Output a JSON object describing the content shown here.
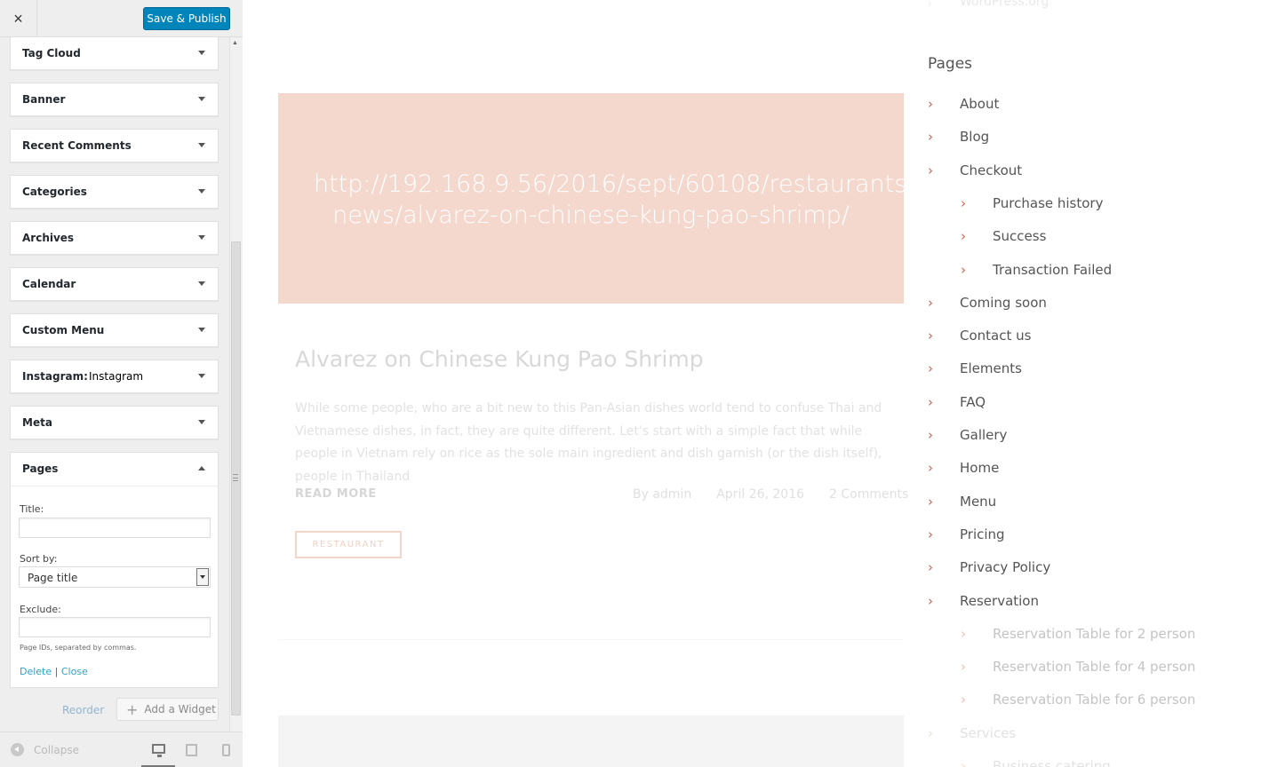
{
  "header": {
    "close_icon": "×",
    "publish_label": "Save & Publish"
  },
  "widgets": [
    {
      "title": "Tag Cloud",
      "sub": ""
    },
    {
      "title": "Banner",
      "sub": ""
    },
    {
      "title": "Recent Comments",
      "sub": ""
    },
    {
      "title": "Categories",
      "sub": ""
    },
    {
      "title": "Archives",
      "sub": ""
    },
    {
      "title": "Calendar",
      "sub": ""
    },
    {
      "title": "Custom Menu",
      "sub": ""
    },
    {
      "title": "Instagram:",
      "sub": "Instagram"
    },
    {
      "title": "Meta",
      "sub": ""
    }
  ],
  "pages_widget": {
    "title": "Pages",
    "title_label": "Title:",
    "title_value": "",
    "sort_label": "Sort by:",
    "sort_value": "Page title",
    "exclude_label": "Exclude:",
    "exclude_value": "",
    "hint": "Page IDs, separated by commas.",
    "delete_label": "Delete",
    "separator": "|",
    "close_label": "Close"
  },
  "actions": {
    "reorder_label": "Reorder",
    "add_widget_label": "Add a Widget"
  },
  "footer": {
    "collapse_label": "Collapse"
  },
  "preview": {
    "banner_text": "http://192.168.9.56/2016/sept/60108/restaurants-news/alvarez-on-chinese-kung-pao-shrimp/",
    "post_title": "Alvarez on Chinese Kung Pao Shrimp",
    "excerpt": "While some people, who are a bit new to this Pan-Asian dishes world tend to confuse Thai and Vietnamese dishes, in fact, they are quite different. Let's start with a simple fact that while people in Vietnam rely on rice as the sole main ingredient and dish garnish (or the dish itself), people in Thailand",
    "read_more": "READ MORE",
    "author": "By admin",
    "date": "April 26, 2016",
    "comments": "2 Comments",
    "tag": "RESTAURANT"
  },
  "pages_sidebar": {
    "top_link": "WordPress.org",
    "heading": "Pages",
    "items": [
      {
        "label": "About",
        "level": 0
      },
      {
        "label": "Blog",
        "level": 0
      },
      {
        "label": "Checkout",
        "level": 0
      },
      {
        "label": "Purchase history",
        "level": 1
      },
      {
        "label": "Success",
        "level": 1
      },
      {
        "label": "Transaction Failed",
        "level": 1
      },
      {
        "label": "Coming soon",
        "level": 0
      },
      {
        "label": "Contact us",
        "level": 0
      },
      {
        "label": "Elements",
        "level": 0
      },
      {
        "label": "FAQ",
        "level": 0
      },
      {
        "label": "Gallery",
        "level": 0
      },
      {
        "label": "Home",
        "level": 0
      },
      {
        "label": "Menu",
        "level": 0
      },
      {
        "label": "Pricing",
        "level": 0
      },
      {
        "label": "Privacy Policy",
        "level": 0
      },
      {
        "label": "Reservation",
        "level": 0
      },
      {
        "label": "Reservation Table for 2 person",
        "level": 1
      },
      {
        "label": "Reservation Table for 4 person",
        "level": 1
      },
      {
        "label": "Reservation Table for 6 person",
        "level": 1
      },
      {
        "label": "Services",
        "level": 0
      },
      {
        "label": "Business catering",
        "level": 1
      }
    ]
  },
  "colors": {
    "accent": "#0085ba",
    "link": "#2ea2cc",
    "chevron": "#d9604a",
    "banner": "#f4d8cd"
  }
}
